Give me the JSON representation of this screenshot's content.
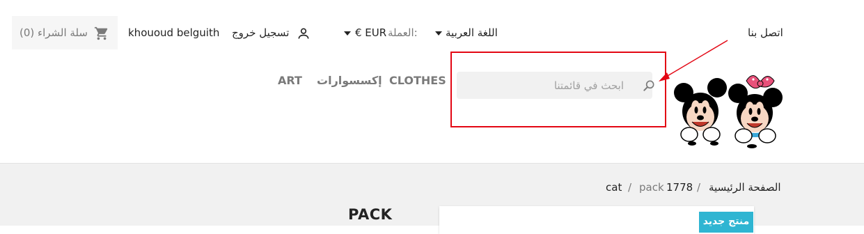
{
  "header": {
    "cart_label": "سلة الشراء (0)",
    "user_name": "khououd belguith",
    "logout_label": "تسجيل خروج",
    "currency_label": "العملة:",
    "currency_value": "€ EUR",
    "language_value": "اللغة العربية",
    "contact_label": "اتصل بنا"
  },
  "menu": {
    "items": [
      "ART",
      "إكسسوارات",
      "CLOTHES"
    ]
  },
  "search": {
    "placeholder": "ابحث في قائمتنا",
    "value": ""
  },
  "breadcrumb": {
    "home": "الصفحة الرئيسية",
    "item2_num": "1778",
    "item2_text": "pack",
    "item3": "cat",
    "separator": "/"
  },
  "page": {
    "title": "PACK",
    "badge": "منتج جديد"
  },
  "colors": {
    "highlight": "#e30613",
    "badge": "#2fb5d2"
  },
  "icons": {
    "cart": "shopping-cart-icon",
    "user": "user-icon",
    "search": "search-icon",
    "logo": "mickey-minnie-logo"
  }
}
